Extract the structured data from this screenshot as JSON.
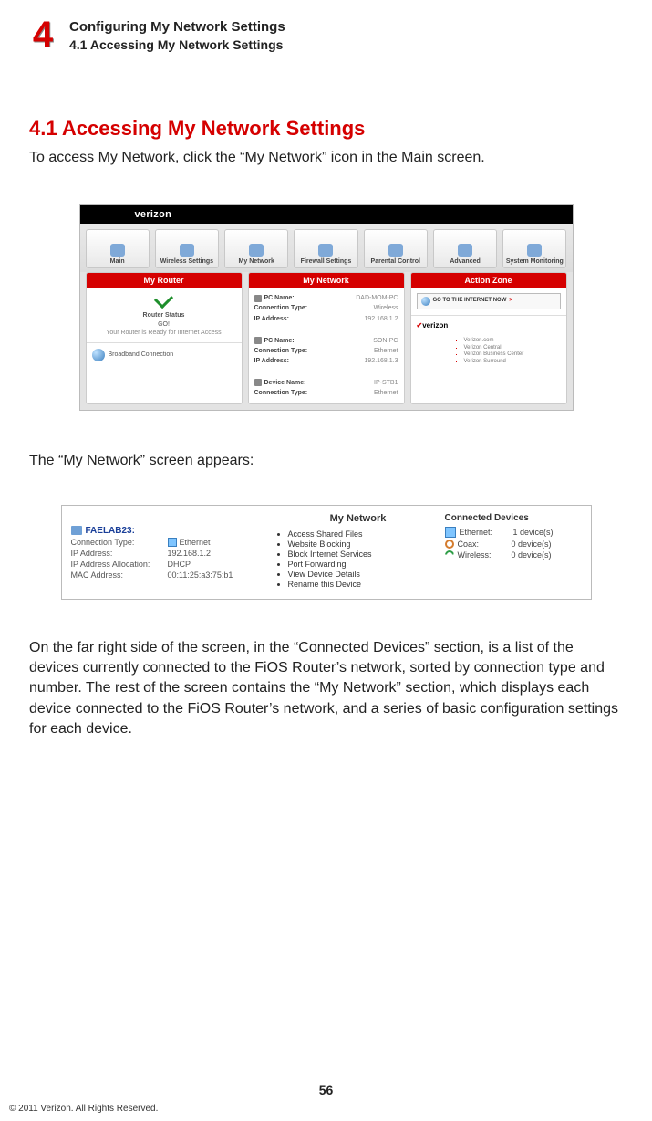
{
  "header": {
    "chapter_number": "4",
    "chapter_title": "Configuring My Network Settings",
    "section_label": "4.1  Accessing My Network Settings"
  },
  "section": {
    "heading": "4.1  Accessing My Network Settings",
    "intro": "To access My Network, click the “My Network” icon in the Main screen.",
    "mid": "The “My Network” screen appears:",
    "desc": "On the far right side of the screen, in the “Connected Devices” section, is a list of the devices currently connected to the FiOS Router’s network, sorted by connection type and number. The rest of the screen contains the “My Network” section, which displays each device connected to the FiOS Router’s network, and a series of basic configuration settings for each device."
  },
  "shot1": {
    "logo": "verizon",
    "tabs": [
      "Main",
      "Wireless Settings",
      "My Network",
      "Firewall Settings",
      "Parental Control",
      "Advanced",
      "System Monitoring"
    ],
    "columns": {
      "left": {
        "title": "My Router",
        "status_label": "Router Status",
        "status_value": "GO!",
        "status_note": "Your Router is Ready for Internet Access",
        "broadband": "Broadband Connection"
      },
      "mid": {
        "title": "My Network",
        "rows": [
          {
            "k": "PC Name:",
            "v": "DAD-MOM-PC"
          },
          {
            "k": "Connection Type:",
            "v": "Wireless"
          },
          {
            "k": "IP Address:",
            "v": "192.168.1.2"
          },
          {
            "k": "PC Name:",
            "v": "SON-PC"
          },
          {
            "k": "Connection Type:",
            "v": "Ethernet"
          },
          {
            "k": "IP Address:",
            "v": "192.168.1.3"
          },
          {
            "k": "Device Name:",
            "v": "IP-STB1"
          },
          {
            "k": "Connection Type:",
            "v": "Ethernet"
          }
        ]
      },
      "right": {
        "title": "Action Zone",
        "go_btn": "GO TO THE INTERNET NOW",
        "brand": "verizon",
        "links": [
          "Verizon.com",
          "Verizon Central",
          "Verizon Business Center",
          "Verizon Surround"
        ]
      }
    }
  },
  "shot2": {
    "title": "My Network",
    "device": {
      "name": "FAELAB23:",
      "fields": [
        {
          "k": "Connection Type:",
          "v": "Ethernet",
          "icon": true
        },
        {
          "k": "IP Address:",
          "v": "192.168.1.2"
        },
        {
          "k": "IP Address Allocation:",
          "v": "DHCP"
        },
        {
          "k": "MAC Address:",
          "v": "00:11:25:a3:75:b1"
        }
      ]
    },
    "actions": [
      "Access Shared Files",
      "Website Blocking",
      "Block Internet Services",
      "Port Forwarding",
      "View Device Details",
      "Rename this Device"
    ],
    "connected": {
      "title": "Connected Devices",
      "rows": [
        {
          "icon": "eth",
          "type": "Ethernet:",
          "count": "1 device(s)"
        },
        {
          "icon": "coax",
          "type": "Coax:",
          "count": "0 device(s)"
        },
        {
          "icon": "wifi",
          "type": "Wireless:",
          "count": "0 device(s)"
        }
      ]
    }
  },
  "footer": {
    "page": "56",
    "copyright": "© 2011 Verizon. All Rights Reserved."
  }
}
